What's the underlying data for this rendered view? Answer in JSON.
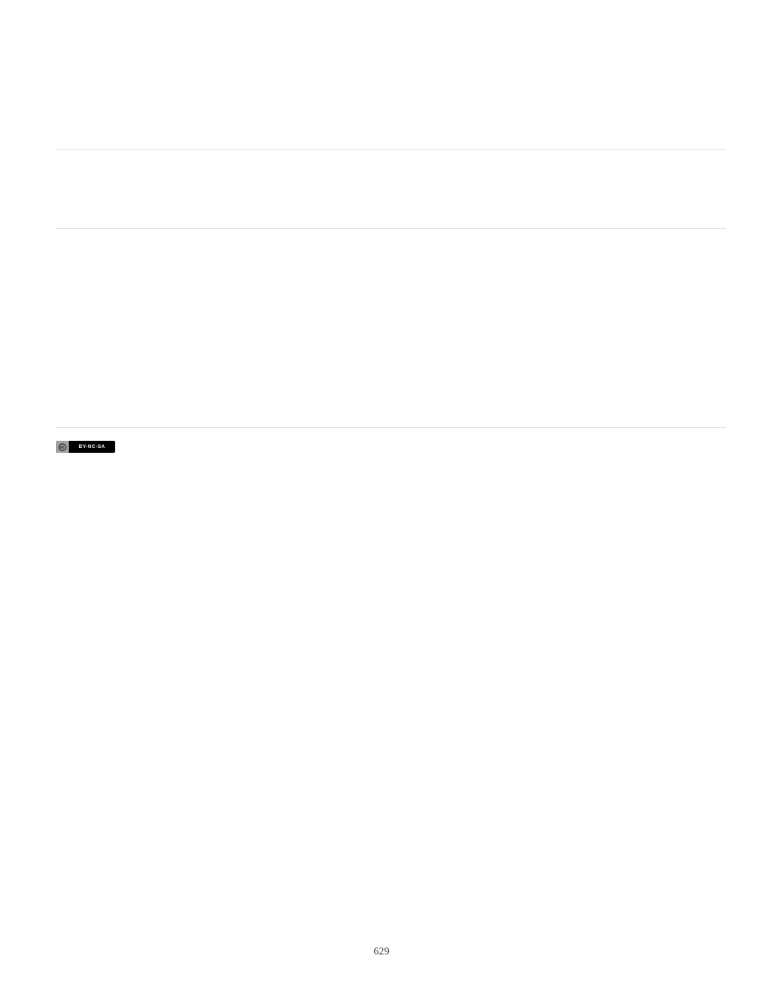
{
  "license": {
    "badge_label": "BY-NC-SA"
  },
  "page_number": "629"
}
